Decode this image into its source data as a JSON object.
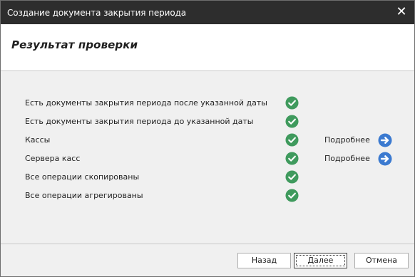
{
  "window": {
    "title": "Создание документа закрытия периода",
    "close_glyph": "✕"
  },
  "header": {
    "title": "Результат проверки"
  },
  "checks": [
    {
      "label": "Есть документы закрытия периода после указанной даты",
      "status": "ok",
      "status_icon": "check-circle-icon",
      "details": null
    },
    {
      "label": "Есть документы закрытия периода до указанной даты",
      "status": "ok",
      "status_icon": "check-circle-icon",
      "details": null
    },
    {
      "label": "Кассы",
      "status": "ok",
      "status_icon": "check-circle-icon",
      "details": "Подробнее",
      "details_icon": "arrow-right-circle-icon"
    },
    {
      "label": "Сервера касс",
      "status": "ok",
      "status_icon": "check-circle-icon",
      "details": "Подробнее",
      "details_icon": "arrow-right-circle-icon"
    },
    {
      "label": "Все операции скопированы",
      "status": "ok",
      "status_icon": "check-circle-icon",
      "details": null
    },
    {
      "label": "Все операции агрегированы",
      "status": "ok",
      "status_icon": "check-circle-icon",
      "details": null
    }
  ],
  "footer": {
    "back_label": "Назад",
    "next_label": "Далее",
    "cancel_label": "Отмена"
  },
  "colors": {
    "titlebar": "#2d2d2d",
    "check_green": "#3f9a5d",
    "arrow_blue": "#3b7ad0"
  }
}
